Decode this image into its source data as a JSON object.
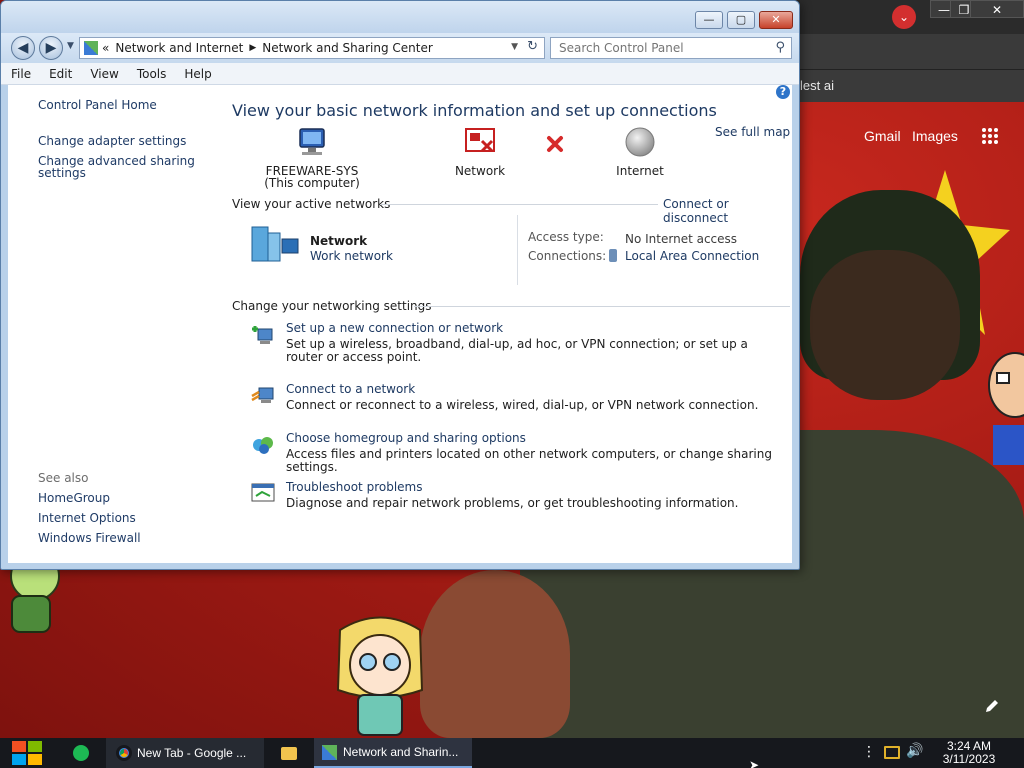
{
  "colors": {
    "window_frame": "#b9d1ea",
    "link": "#1f3b66",
    "title": "#1e3a63",
    "close_button": "#c7422b",
    "wallpaper": "#a81c15",
    "taskbar": "#16181d"
  },
  "window": {
    "address_path": [
      "Network and Internet",
      "Network and Sharing Center"
    ],
    "search_placeholder": "Search Control Panel",
    "menu": [
      "File",
      "Edit",
      "View",
      "Tools",
      "Help"
    ],
    "left_nav": {
      "links": [
        "Control Panel Home",
        "Change adapter settings",
        "Change advanced sharing settings"
      ],
      "see_also_label": "See also",
      "see_also": [
        "HomeGroup",
        "Internet Options",
        "Windows Firewall"
      ]
    },
    "main": {
      "title": "View your basic network information and set up connections",
      "see_full_map": "See full map",
      "map": {
        "computer_name": "FREEWARE-SYS",
        "computer_sub": "(This computer)",
        "network": "Network",
        "internet": "Internet"
      },
      "active_networks_heading": "View your active networks",
      "connect_or_disconnect": "Connect or disconnect",
      "active_network": {
        "name": "Network",
        "type": "Work network",
        "access_type_label": "Access type:",
        "access_type_value": "No Internet access",
        "connections_label": "Connections:",
        "connections_value": "Local Area Connection"
      },
      "settings_heading": "Change your networking settings",
      "tasks": [
        {
          "title": "Set up a new connection or network",
          "desc": "Set up a wireless, broadband, dial-up, ad hoc, or VPN connection; or set up a router or access point."
        },
        {
          "title": "Connect to a network",
          "desc": "Connect or reconnect to a wireless, wired, dial-up, or VPN network connection."
        },
        {
          "title": "Choose homegroup and sharing options",
          "desc": "Access files and printers located on other network computers, or change sharing settings."
        },
        {
          "title": "Troubleshoot problems",
          "desc": "Diagnose and repair network problems, or get troubleshooting information."
        }
      ]
    }
  },
  "chrome": {
    "bookmark_fragment": "lest ai",
    "gmail": "Gmail",
    "images": "Images"
  },
  "taskbar": {
    "items": [
      "New Tab - Google ...",
      "Network and Sharin..."
    ],
    "time": "3:24 AM",
    "date": "3/11/2023"
  }
}
